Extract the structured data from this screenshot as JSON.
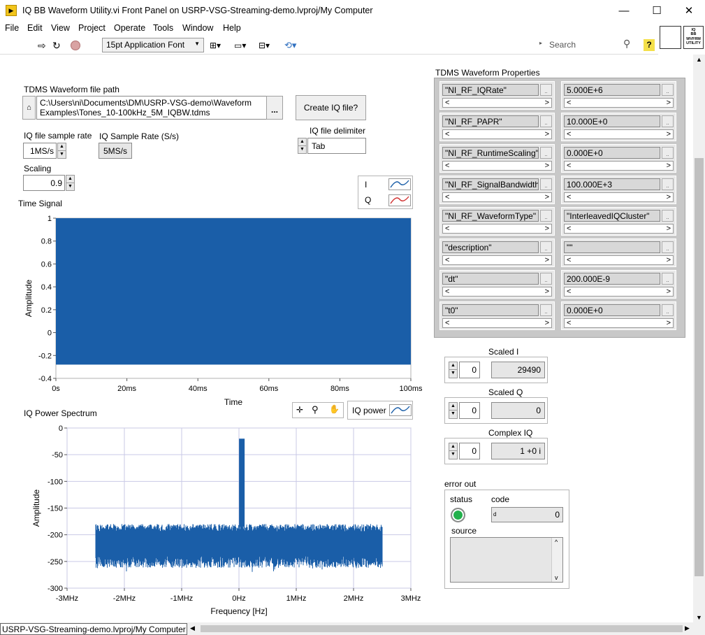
{
  "window": {
    "title": "IQ BB Waveform Utility.vi Front Panel on USRP-VSG-Streaming-demo.lvproj/My Computer",
    "minimize": "—",
    "maximize": "☐",
    "close": "✕"
  },
  "menu": [
    "File",
    "Edit",
    "View",
    "Project",
    "Operate",
    "Tools",
    "Window",
    "Help"
  ],
  "toolbar": {
    "font": "15pt Application Font",
    "search_placeholder": "Search",
    "icon_text": [
      "IQ",
      "BB",
      "WVFRM",
      "UTILITY"
    ]
  },
  "panel": {
    "file_path_label": "TDMS Waveform file path",
    "file_path_line1": "C:\\Users\\ni\\Documents\\DM\\USRP-VSG-demo\\Waveform",
    "file_path_line2": "Examples\\Tones_10-100kHz_5M_IQBW.tdms",
    "browse": "...",
    "create_button": "Create IQ file?",
    "iq_rate_label": "IQ file sample rate",
    "iq_rate_value": "1MS/s",
    "sample_rate_label": "IQ Sample Rate (S/s)",
    "sample_rate_value": "5MS/s",
    "delimiter_label": "IQ file delimiter",
    "delimiter_value": "Tab",
    "scaling_label": "Scaling",
    "scaling_value": "0.9",
    "legend_i": "I",
    "legend_q": "Q",
    "iq_power_legend": "IQ power"
  },
  "props": {
    "title": "TDMS Waveform Properties",
    "rows": [
      {
        "key": "\"NI_RF_IQRate\"",
        "val": "5.000E+6"
      },
      {
        "key": "\"NI_RF_PAPR\"",
        "val": "10.000E+0"
      },
      {
        "key": "\"NI_RF_RuntimeScaling\"",
        "val": "0.000E+0"
      },
      {
        "key": "\"NI_RF_SignalBandwidth\"",
        "val": "100.000E+3"
      },
      {
        "key": "\"NI_RF_WaveformType\"",
        "val": "\"InterleavedIQCluster\""
      },
      {
        "key": "\"description\"",
        "val": "\"\""
      },
      {
        "key": "\"dt\"",
        "val": "200.000E-9"
      },
      {
        "key": "\"t0\"",
        "val": "0.000E+0"
      }
    ]
  },
  "outputs": {
    "scaled_i_label": "Scaled I",
    "scaled_i_index": "0",
    "scaled_i_value": "29490",
    "scaled_q_label": "Scaled Q",
    "scaled_q_index": "0",
    "scaled_q_value": "0",
    "complex_label": "Complex IQ",
    "complex_index": "0",
    "complex_value": "1 +0 i"
  },
  "error": {
    "label": "error out",
    "status_label": "status",
    "code_label": "code",
    "code_prefix": "d",
    "code_value": "0",
    "source_label": "source",
    "status_color": "#22b14c"
  },
  "statusbar": {
    "text": "USRP-VSG-Streaming-demo.lvproj/My Computer"
  },
  "colors": {
    "plot": "#1a5ea8",
    "grid": "#c9c9e6"
  },
  "chart_data": [
    {
      "type": "line",
      "title": "Time Signal",
      "xlabel": "Time",
      "ylabel": "Amplitude",
      "xlim": [
        0,
        100
      ],
      "ylim": [
        -0.4,
        1
      ],
      "x_tick_labels": [
        "0s",
        "20ms",
        "40ms",
        "60ms",
        "80ms",
        "100ms"
      ],
      "x_ticks": [
        0,
        20,
        40,
        60,
        80,
        100
      ],
      "y_ticks": [
        -0.4,
        -0.2,
        0,
        0.2,
        0.4,
        0.6,
        0.8,
        1
      ],
      "y_tick_labels": [
        "-0.4",
        "-0.2",
        "0",
        "0.2",
        "0.4",
        "0.6",
        "0.8",
        "1"
      ],
      "grid": false,
      "series": [
        {
          "name": "I",
          "color": "#1a5ea8",
          "envelope": {
            "x": [
              0,
              100
            ],
            "min": -0.28,
            "max": 1
          }
        },
        {
          "name": "Q",
          "color": "#d03030",
          "visible": false
        }
      ]
    },
    {
      "type": "line",
      "title": "IQ Power Spectrum",
      "xlabel": "Frequency [Hz]",
      "ylabel": "Amplitude",
      "xlim": [
        -3,
        3
      ],
      "ylim": [
        -300,
        0
      ],
      "x_ticks": [
        -3,
        -2,
        -1,
        0,
        1,
        2,
        3
      ],
      "x_tick_labels": [
        "-3MHz",
        "-2MHz",
        "-1MHz",
        "0Hz",
        "1MHz",
        "2MHz",
        "3MHz"
      ],
      "y_ticks": [
        0,
        -50,
        -100,
        -150,
        -200,
        -250,
        -300
      ],
      "y_tick_labels": [
        "0",
        "-50",
        "-100",
        "-150",
        "-200",
        "-250",
        "-300"
      ],
      "grid": true,
      "series": [
        {
          "name": "IQ power",
          "color": "#1a5ea8",
          "noise": {
            "x": [
              -2.5,
              2.5
            ],
            "min": -262,
            "max": -180
          },
          "peak": {
            "x": 0.05,
            "y": -20
          }
        }
      ]
    }
  ]
}
